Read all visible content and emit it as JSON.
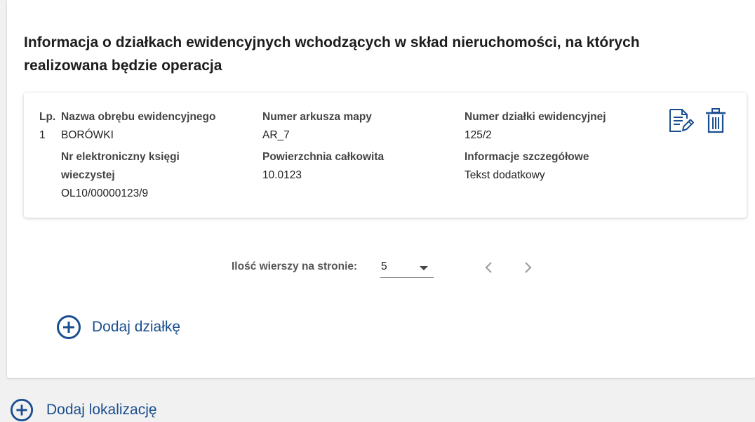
{
  "section": {
    "title": "Informacja o działkach ewidencyjnych wchodzących w skład nieruchomości, na których realizowana będzie operacja"
  },
  "record": {
    "lp_label": "Lp.",
    "lp_value": "1",
    "fields": {
      "obreb": {
        "label": "Nazwa obrębu ewidencyjnego",
        "value": "BORÓWKI"
      },
      "arkusz": {
        "label": "Numer arkusza mapy",
        "value": "AR_7"
      },
      "dzialka": {
        "label": "Numer działki ewidencyjnej",
        "value": "125/2"
      },
      "ksiega": {
        "label": "Nr elektroniczny księgi wieczystej",
        "value": "OL10/00000123/9"
      },
      "powierzchnia": {
        "label": "Powierzchnia całkowita",
        "value": "10.0123"
      },
      "informacje": {
        "label": "Informacje szczegółowe",
        "value": "Tekst dodatkowy"
      }
    },
    "actions": {
      "edit_icon": "edit-document-icon",
      "delete_icon": "trash-icon"
    }
  },
  "pagination": {
    "rows_label": "Ilość wierszy na stronie:",
    "rows_value": "5",
    "prev_icon": "chevron-left-icon",
    "next_icon": "chevron-right-icon"
  },
  "buttons": {
    "add_plot": "Dodaj działkę",
    "add_location": "Dodaj lokalizację"
  },
  "colors": {
    "accent": "#1a4e8f",
    "background": "#f1f1f1",
    "panel": "#ffffff"
  }
}
